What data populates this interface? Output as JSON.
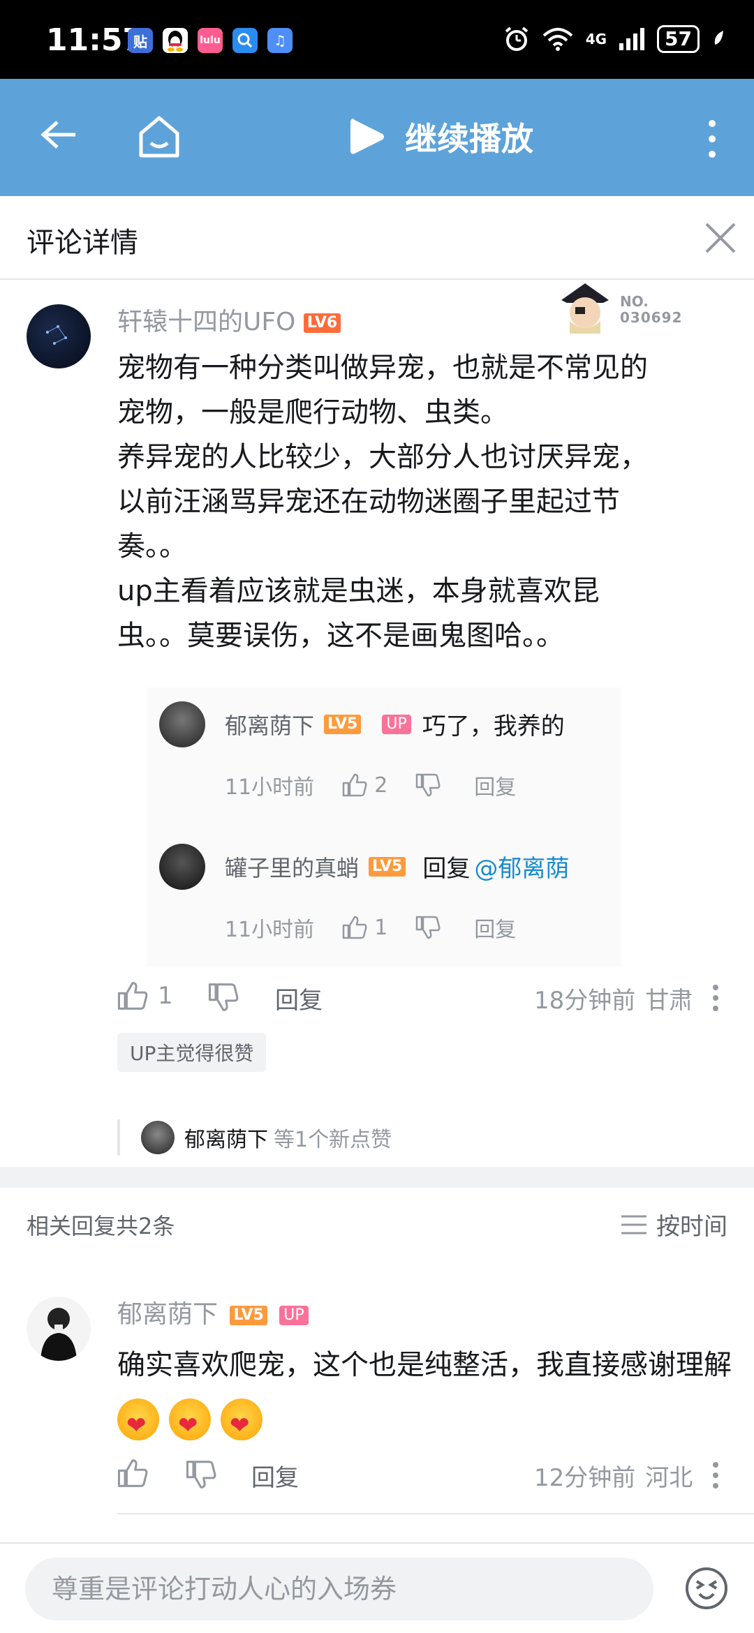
{
  "status_bar": {
    "time": "11:57",
    "battery": "57",
    "network": "4G",
    "app_icons": [
      "tieba-icon",
      "qq-icon",
      "app-icon",
      "search-app-icon",
      "music-app-icon"
    ]
  },
  "topbar": {
    "play_label": "继续播放",
    "bg_color": "#5da3d9"
  },
  "detail": {
    "title": "评论详情"
  },
  "main_comment": {
    "username": "轩辕十四的UFO",
    "level": "LV6",
    "fan_badge_no": "NO.",
    "fan_badge_num": "030692",
    "text": "宠物有一种分类叫做异宠，也就是不常见的\n宠物，一般是爬行动物、虫类。\n养异宠的人比较少，大部分人也讨厌异宠，\n以前汪涵骂异宠还在动物迷圈子里起过节\n奏。。\nup主看着应该就是虫迷，本身就喜欢昆\n虫。。莫要误伤，这不是画鬼图哈。。",
    "likes": "1",
    "reply_label": "回复",
    "time": "18分钟前",
    "location": "甘肃",
    "up_liked": "UP主觉得很赞",
    "like_notice_user": "郁离荫下",
    "like_notice_suffix": "等1个新点赞"
  },
  "image_replies": [
    {
      "username": "郁离荫下",
      "level": "LV5",
      "up": "UP",
      "text": "巧了，我养的",
      "time": "11小时前",
      "likes": "2",
      "reply": "回复"
    },
    {
      "username": "罐子里的真蛸",
      "level": "LV5",
      "text_prefix": "回复",
      "mention": "@郁离荫",
      "time": "11小时前",
      "likes": "1",
      "reply": "回复"
    }
  ],
  "related": {
    "count_label": "相关回复共2条",
    "sort_label": "按时间"
  },
  "reply_comment": {
    "username": "郁离荫下",
    "level": "LV5",
    "up": "UP",
    "text": "确实喜欢爬宠，这个也是纯整活，我直接感谢理解",
    "reply_label": "回复",
    "time": "12分钟前",
    "location": "河北"
  },
  "bottom": {
    "input_placeholder": "尊重是评论打动人心的入场券"
  }
}
